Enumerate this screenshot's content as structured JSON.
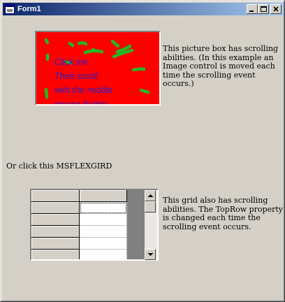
{
  "window": {
    "title": "Form1"
  },
  "titlebar_buttons": {
    "minimize": "minimize-icon",
    "maximize": "maximize-icon",
    "close": "close-icon"
  },
  "picture_box": {
    "text_lines": [
      "Click me",
      "Then scroll",
      "with the middle",
      "mouse button"
    ],
    "background_color": "#ff0000",
    "text_color": "#2323c8",
    "stroke_color": "#22b822"
  },
  "picture_box_description": [
    "This picture box has scrolling",
    "abilities.  (In this example an",
    "Image control is moved each",
    "time the scrolling event occurs.)"
  ],
  "flexgrid_prompt": "Or click this MSFLEXGIRD",
  "grid_description": [
    "This grid also has scrolling",
    "abilities.  The TopRow property",
    "is changed each time the",
    "scrolling event occurs."
  ],
  "grid": {
    "rows": 6,
    "fixed_rows": 1,
    "fixed_cols": 1,
    "cols": 2,
    "selected_cell": "row 1, col 1"
  },
  "scrollbar": {
    "up_icon": "scroll-up-arrow-icon",
    "down_icon": "scroll-down-arrow-icon"
  }
}
